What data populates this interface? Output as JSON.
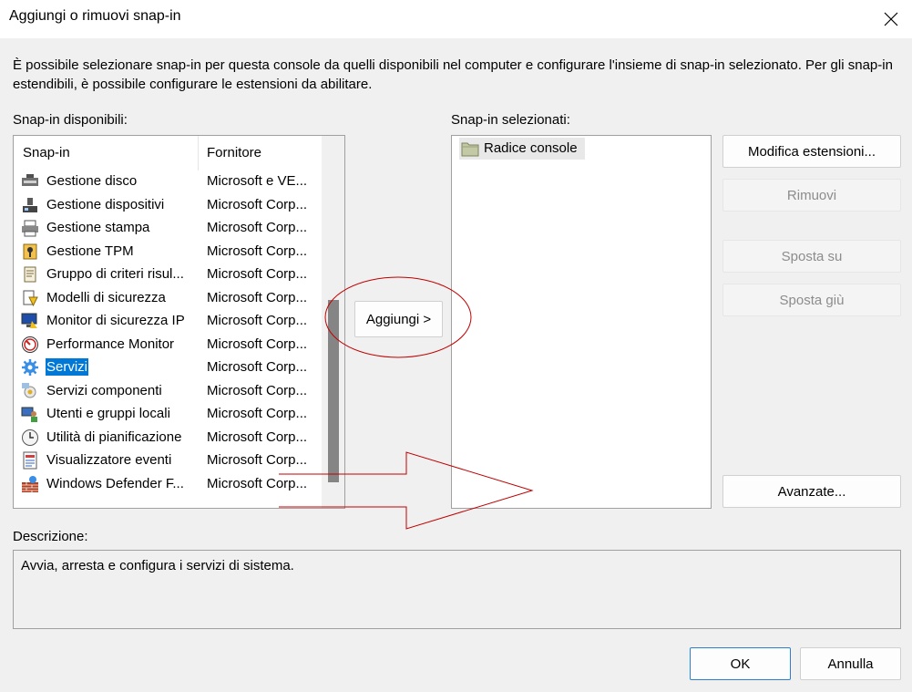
{
  "window": {
    "title": "Aggiungi o rimuovi snap-in",
    "close_icon": "close-icon"
  },
  "intro": "È possibile selezionare snap-in per questa console da quelli disponibili nel computer e configurare l'insieme di snap-in selezionato. Per gli snap-in estendibili, è possibile configurare le estensioni da abilitare.",
  "available": {
    "label": "Snap-in disponibili:",
    "columns": [
      "Snap-in",
      "Fornitore"
    ],
    "rows": [
      {
        "name": "Gestione disco",
        "vendor": "Microsoft e VE...",
        "icon": "disk-management-icon"
      },
      {
        "name": "Gestione dispositivi",
        "vendor": "Microsoft Corp...",
        "icon": "device-manager-icon"
      },
      {
        "name": "Gestione stampa",
        "vendor": "Microsoft Corp...",
        "icon": "printer-icon"
      },
      {
        "name": "Gestione TPM",
        "vendor": "Microsoft Corp...",
        "icon": "tpm-chip-icon"
      },
      {
        "name": "Gruppo di criteri risul...",
        "vendor": "Microsoft Corp...",
        "icon": "policy-scroll-icon"
      },
      {
        "name": "Modelli di sicurezza",
        "vendor": "Microsoft Corp...",
        "icon": "security-template-icon"
      },
      {
        "name": "Monitor di sicurezza IP",
        "vendor": "Microsoft Corp...",
        "icon": "ip-security-monitor-icon"
      },
      {
        "name": "Performance Monitor",
        "vendor": "Microsoft Corp...",
        "icon": "performance-monitor-icon"
      },
      {
        "name": "Servizi",
        "vendor": "Microsoft Corp...",
        "icon": "services-gear-icon",
        "selected": true
      },
      {
        "name": "Servizi componenti",
        "vendor": "Microsoft Corp...",
        "icon": "component-services-icon"
      },
      {
        "name": "Utenti e gruppi locali",
        "vendor": "Microsoft Corp...",
        "icon": "users-groups-icon"
      },
      {
        "name": "Utilità di pianificazione",
        "vendor": "Microsoft Corp...",
        "icon": "task-scheduler-clock-icon"
      },
      {
        "name": "Visualizzatore eventi",
        "vendor": "Microsoft Corp...",
        "icon": "event-viewer-icon"
      },
      {
        "name": "Windows Defender F...",
        "vendor": "Microsoft Corp...",
        "icon": "firewall-icon"
      }
    ]
  },
  "add_button": "Aggiungi >",
  "selected": {
    "label": "Snap-in selezionati:",
    "items": [
      {
        "name": "Radice console",
        "icon": "folder-icon"
      }
    ]
  },
  "buttons": {
    "edit_extensions": "Modifica estensioni...",
    "remove": "Rimuovi",
    "move_up": "Sposta su",
    "move_down": "Sposta giù",
    "advanced": "Avanzate...",
    "ok": "OK",
    "cancel": "Annulla"
  },
  "description": {
    "label": "Descrizione:",
    "text": "Avvia, arresta e configura i servizi di sistema."
  },
  "colors": {
    "selection": "#0078d7",
    "annotation": "#c00000"
  }
}
